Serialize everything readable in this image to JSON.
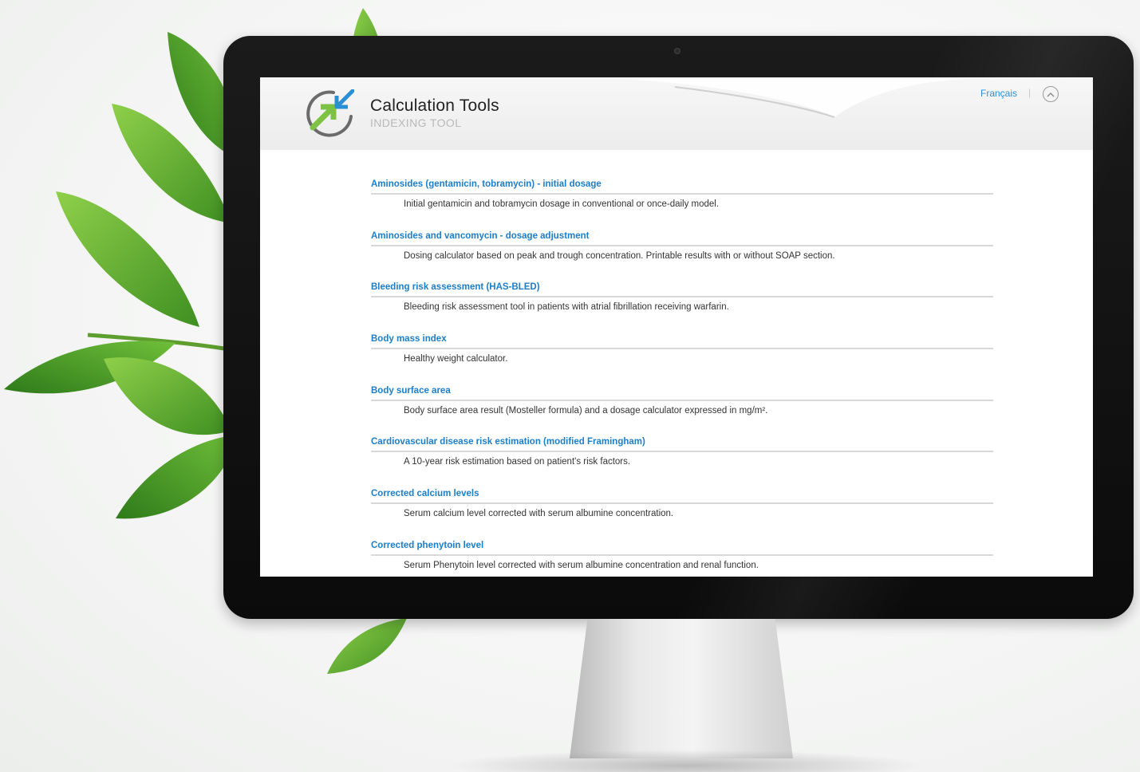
{
  "app": {
    "title": "Calculation Tools",
    "subtitle": "INDEXING TOOL",
    "language_link": "Français",
    "separator": "|"
  },
  "colors": {
    "link_blue": "#1a7ec8",
    "logo_green": "#7dc242",
    "header_bg": "#ececec"
  },
  "tools": [
    {
      "title": "Aminosides (gentamicin, tobramycin) - initial dosage",
      "description": "Initial gentamicin and tobramycin dosage in conventional or once-daily model."
    },
    {
      "title": "Aminosides and vancomycin - dosage adjustment",
      "description": "Dosing calculator based on peak and trough concentration. Printable results with or without SOAP section."
    },
    {
      "title": "Bleeding risk assessment (HAS-BLED)",
      "description": "Bleeding risk assessment tool in patients with atrial fibrillation receiving warfarin."
    },
    {
      "title": "Body mass index",
      "description": "Healthy weight calculator."
    },
    {
      "title": "Body surface area",
      "description": "Body surface area result (Mosteller formula) and a dosage calculator expressed in mg/m²."
    },
    {
      "title": "Cardiovascular disease risk estimation (modified Framingham)",
      "description": "A 10-year risk estimation based on patient's risk factors."
    },
    {
      "title": "Corrected calcium levels",
      "description": "Serum calcium level corrected with serum albumine concentration."
    },
    {
      "title": "Corrected phenytoin level",
      "description": "Serum Phenytoin level corrected with serum albumine concentration and renal function."
    }
  ],
  "icons": {
    "logo": "calculation-tools-logo-icon",
    "up": "chevron-up-icon"
  }
}
